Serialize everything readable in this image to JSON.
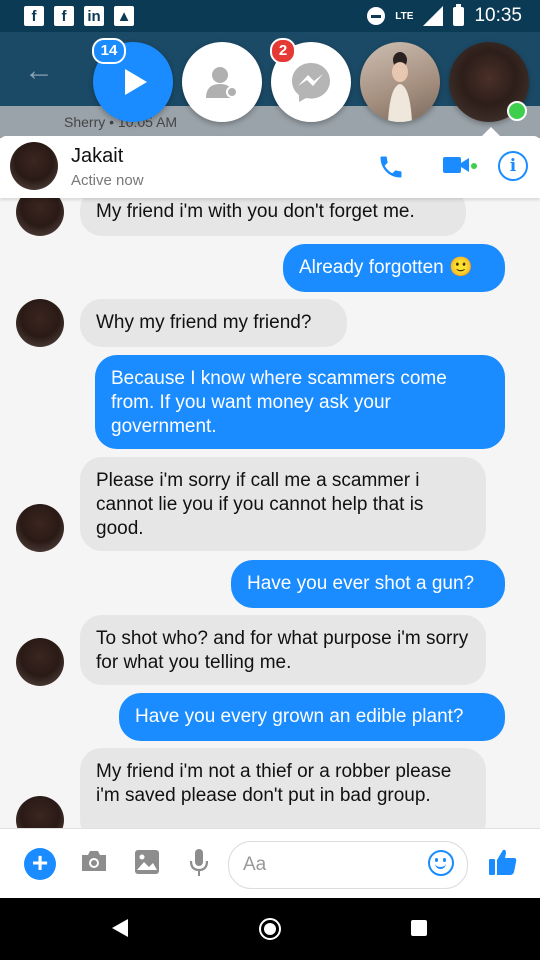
{
  "status_bar": {
    "time": "10:35",
    "network": "LTE"
  },
  "background_app": {
    "time_label": "Sherry • 10:05 AM"
  },
  "chat_heads": {
    "unread_badge": "14",
    "messenger_badge": "2"
  },
  "header": {
    "name": "Jakait",
    "status": "Active now"
  },
  "messages": [
    {
      "dir": "in",
      "text": "My friend i'm with you don't forget me."
    },
    {
      "dir": "out",
      "text": "Already forgotten 🙂"
    },
    {
      "dir": "in",
      "text": "Why my friend my friend?"
    },
    {
      "dir": "out",
      "text": "Because I know where scammers come from.  If you want money ask your government."
    },
    {
      "dir": "in",
      "text": "Please i'm sorry if call me a scammer i cannot lie you if you cannot help that is good."
    },
    {
      "dir": "out",
      "text": "Have you ever shot a gun?"
    },
    {
      "dir": "in",
      "text": "To shot who? and for what purpose i'm sorry for what you telling me."
    },
    {
      "dir": "out",
      "text": "Have you every grown an edible plant?"
    },
    {
      "dir": "in",
      "text": "My friend i'm not a thief or a robber please i'm saved please don't put in bad group."
    }
  ],
  "composer": {
    "placeholder": "Aa"
  },
  "colors": {
    "accent": "#1a8cff",
    "incoming_bubble": "#e6e6e6",
    "status_bar": "#0b3a54",
    "online": "#3ecf4c"
  }
}
